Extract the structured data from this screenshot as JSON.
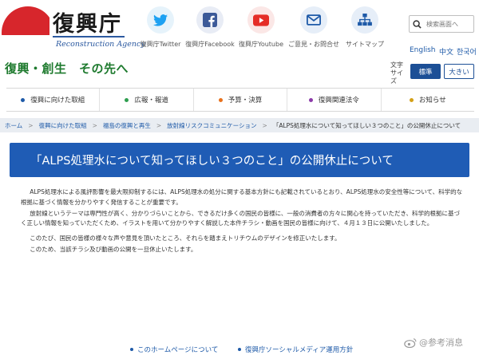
{
  "logo": {
    "kanji": "復興庁",
    "english": "Reconstruction Agency",
    "slogan": "復興・創生　その先へ",
    "sun_color": "#d7262c"
  },
  "header_links": [
    {
      "icon": "twitter-icon",
      "label": "復興庁Twitter",
      "color": "#1da1f2"
    },
    {
      "icon": "facebook-icon",
      "label": "復興庁Facebook",
      "color": "#3b5998"
    },
    {
      "icon": "youtube-icon",
      "label": "復興庁Youtube",
      "color": "#e52d27"
    },
    {
      "icon": "mail-icon",
      "label": "ご意見・お問合せ",
      "color": "#1e5aa8"
    },
    {
      "icon": "sitemap-icon",
      "label": "サイトマップ",
      "color": "#1e5aa8"
    }
  ],
  "search": {
    "placeholder": "検索画面へ"
  },
  "languages": [
    "English",
    "中文",
    "한국어"
  ],
  "font_size": {
    "label": "文字サイズ",
    "standard": "標準",
    "large": "大きい"
  },
  "nav": [
    {
      "label": "復興に向けた取組",
      "color": "#1e5aa8"
    },
    {
      "label": "広報・報道",
      "color": "#2e9e4f"
    },
    {
      "label": "予算・決算",
      "color": "#e8711c"
    },
    {
      "label": "復興関連法令",
      "color": "#8b3aa8"
    },
    {
      "label": "お知らせ",
      "color": "#d4a017"
    }
  ],
  "breadcrumb": [
    "ホーム",
    "復興に向けた取組",
    "福島の復興と再生",
    "放射線リスクコミュニケーション",
    "「ALPS処理水について知ってほしい３つのこと」の公開休止について"
  ],
  "page_title": "「ALPS処理水について知ってほしい３つのこと」の公開休止について",
  "body": [
    "ALPS処理水による風評影響を最大限抑制するには、ALPS処理水の処分に関する基本方針にも記載されているとおり、ALPS処理水の安全性等について、科学的な根拠に基づく情報を分かりやすく発信することが重要です。",
    "放射線というテーマは専門性が高く、分かりづらいことから、できるだけ多くの国民の皆様に、一般の消費者の方々に関心を持っていただき、科学的根拠に基づく正しい情報を知っていただくため、イラストを用いて分かりやすく解説した本件チラシ・動画を国民の皆様に向けて、４月１３日に公開いたしました。",
    "このたび、国民の皆様の様々な声や意見を頂いたところ、それらを踏まえトリチウムのデザインを修正いたします。",
    "このため、当該チラシ及び動画の公開を一旦休止いたします。"
  ],
  "footer_links": [
    "このホームページについて",
    "復興庁ソーシャルメディア運用方針"
  ],
  "watermark": "@参考消息"
}
